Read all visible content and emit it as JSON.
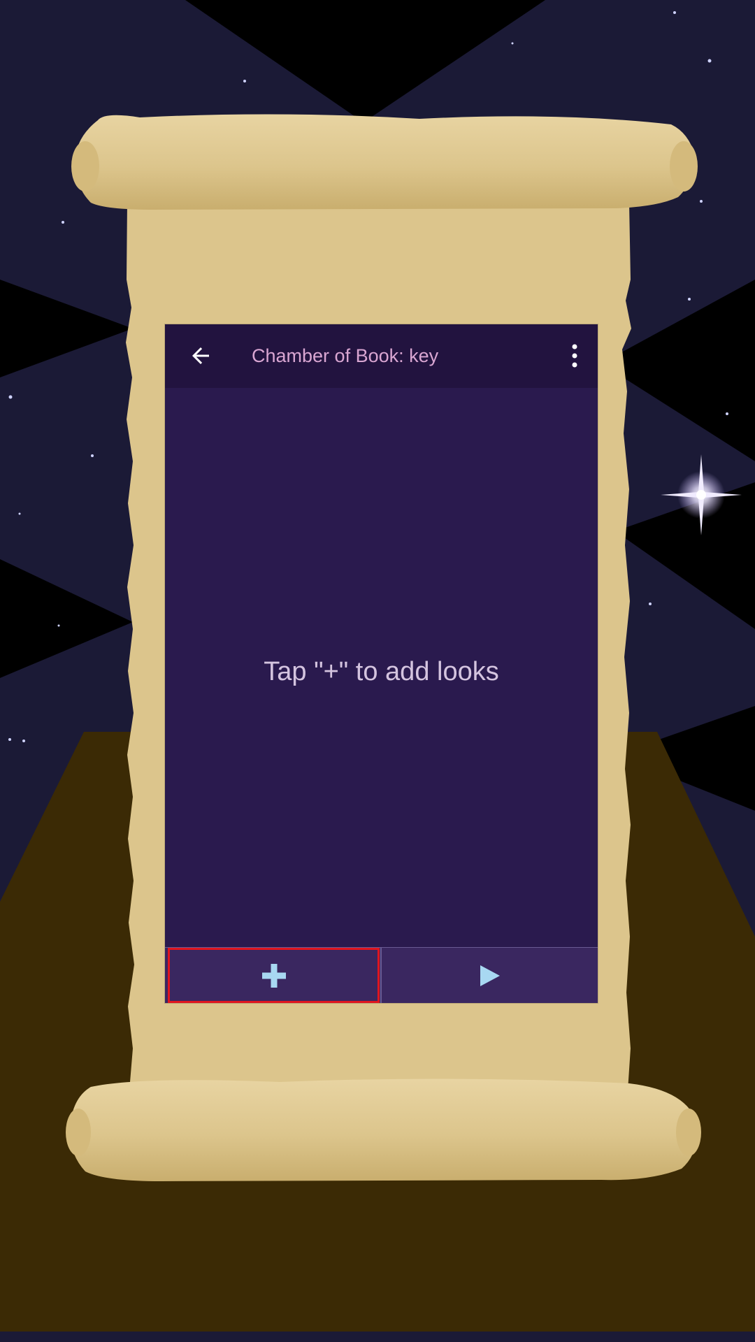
{
  "toolbar": {
    "title": "Chamber of Book: key",
    "back_icon": "arrow-left-icon",
    "menu_icon": "more-vert-icon"
  },
  "main": {
    "empty_message": "Tap \"+\" to add looks"
  },
  "bottom_bar": {
    "add_icon": "plus-icon",
    "play_icon": "play-icon"
  },
  "colors": {
    "sky": "#1b1a36",
    "floor": "#3b2a05",
    "parchment": "#dcc58c",
    "app_background": "#2a1a4e",
    "toolbar_background": "#22133f",
    "title_text": "#d9a6d2",
    "hint_text": "#d4c4df",
    "bottom_bar": "#3a2760",
    "icon_accent": "#a8d8f2",
    "highlight_outline": "#e0161f"
  }
}
